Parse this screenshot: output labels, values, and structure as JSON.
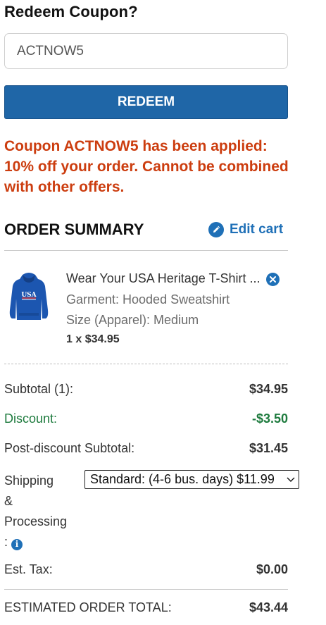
{
  "coupon": {
    "title": "Redeem Coupon?",
    "input_value": "ACTNOW5",
    "redeem_label": "REDEEM",
    "message": "Coupon ACTNOW5 has been applied: 10% off your order. Cannot be combined with other offers."
  },
  "summary": {
    "title": "ORDER SUMMARY",
    "edit_cart_label": "Edit cart",
    "edit_icon": "pencil-icon"
  },
  "item": {
    "title": "Wear Your USA Heritage T-Shirt ...",
    "garment": "Garment: Hooded Sweatshirt",
    "size": "Size (Apparel): Medium",
    "quantity_price": "1 x $34.95",
    "image_text": "USA",
    "remove_icon": "close-circle-icon"
  },
  "totals": {
    "subtotal_label": "Subtotal (1):",
    "subtotal_value": "$34.95",
    "discount_label": "Discount:",
    "discount_value": "-$3.50",
    "post_discount_label": "Post-discount Subtotal:",
    "post_discount_value": "$31.45",
    "shipping_label_lines": [
      "Shipping",
      "&",
      "Processing",
      ":"
    ],
    "shipping_selected": "Standard: (4-6 bus. days) $11.99",
    "tax_label": "Est. Tax:",
    "tax_value": "$0.00",
    "total_label": "ESTIMATED ORDER TOTAL:",
    "total_value": "$43.44"
  },
  "colors": {
    "primary_blue": "#1f66a7",
    "link_blue": "#1f70b7",
    "message_orange": "#cc3d0f",
    "discount_green": "#1e7b3e"
  }
}
